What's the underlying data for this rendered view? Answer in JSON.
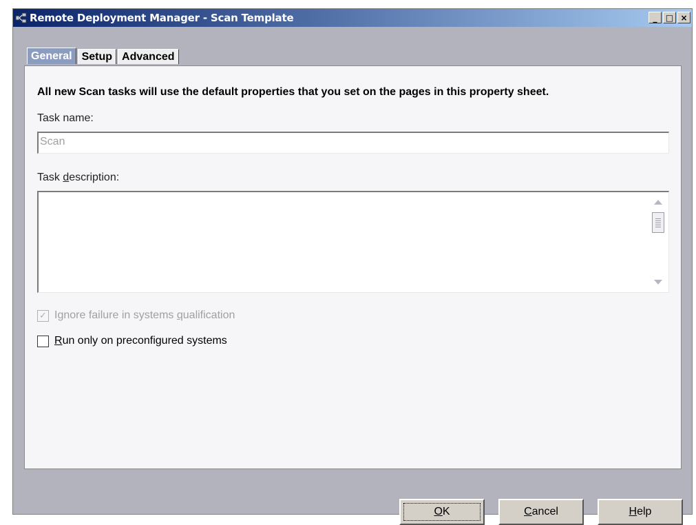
{
  "window": {
    "title": "Remote Deployment Manager - Scan Template",
    "controls": {
      "minimize": "_",
      "maximize": "□",
      "close": "×"
    }
  },
  "tabs": [
    {
      "label": "General",
      "active": true
    },
    {
      "label": "Setup",
      "active": false
    },
    {
      "label": "Advanced",
      "active": false
    }
  ],
  "general": {
    "intro": "All new Scan tasks will use the default properties that you set on the pages in this property sheet.",
    "task_name_label": "Task name:",
    "task_name_value": "Scan",
    "task_description_label_pre": "Task ",
    "task_description_label_mnemonic": "d",
    "task_description_label_post": "escription:",
    "task_description_value": "",
    "ignore_failure": {
      "pre": "Ignore failure in systems ",
      "mnemonic": "q",
      "post": "ualification",
      "checked": true,
      "disabled": true
    },
    "run_only": {
      "pre": "",
      "mnemonic": "R",
      "post": "un only on preconfigured systems",
      "checked": false,
      "disabled": false
    }
  },
  "buttons": {
    "ok": {
      "mnemonic": "O",
      "rest": "K"
    },
    "cancel": {
      "mnemonic": "C",
      "rest": "ancel"
    },
    "help": {
      "mnemonic": "H",
      "rest": "elp"
    }
  },
  "colors": {
    "titlebar_start": "#0a246a",
    "titlebar_end": "#a6caf0",
    "active_tab": "#8c9cbf",
    "window_face": "#d4d0c8",
    "panel_background": "#f6f6f9"
  },
  "icons": [
    "app-icon",
    "minimize-icon",
    "maximize-icon",
    "close-icon",
    "scroll-up-icon",
    "scroll-down-icon",
    "checkmark-icon"
  ]
}
